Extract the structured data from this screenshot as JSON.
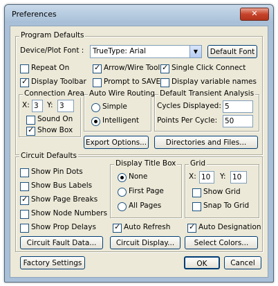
{
  "window": {
    "title": "Preferences",
    "close_label": "✕"
  },
  "program_defaults": {
    "legend": "Program Defaults",
    "font_label": "Device/Plot Font :",
    "font_value": "TrueType: Arial",
    "default_font_button": "Default Font",
    "checkboxes": [
      {
        "label": "Repeat On",
        "checked": false
      },
      {
        "label": "Arrow/Wire Tool",
        "checked": true
      },
      {
        "label": "Single Click Connect",
        "checked": true
      },
      {
        "label": "Display Toolbar",
        "checked": true
      },
      {
        "label": "Prompt to SAVE",
        "checked": false
      },
      {
        "label": "Display variable names",
        "checked": false
      }
    ],
    "connection_area": {
      "legend": "Connection Area",
      "x_label": "X:",
      "x_value": "3",
      "y_label": "Y:",
      "y_value": "3",
      "sound_on": {
        "label": "Sound On",
        "checked": false
      },
      "show_box": {
        "label": "Show Box",
        "checked": true
      }
    },
    "auto_wire_routing": {
      "legend": "Auto Wire Routing",
      "options": [
        {
          "label": "Simple",
          "selected": false
        },
        {
          "label": "Intelligent",
          "selected": true
        }
      ]
    },
    "default_transient": {
      "legend": "Default Transient Analysis",
      "cycles_label": "Cycles Displayed:",
      "cycles_value": "5",
      "points_label": "Points Per Cycle:",
      "points_value": "50"
    },
    "export_button": "Export Options...",
    "directories_button": "Directories and Files..."
  },
  "circuit_defaults": {
    "legend": "Circuit Defaults",
    "checkboxes": [
      {
        "label": "Show Pin Dots",
        "checked": false
      },
      {
        "label": "Show Bus Labels",
        "checked": false
      },
      {
        "label": "Show Page Breaks",
        "checked": true
      },
      {
        "label": "Show Node Numbers",
        "checked": false
      },
      {
        "label": "Show Prop Delays",
        "checked": false
      }
    ],
    "display_title_box": {
      "legend": "Display Title Box",
      "options": [
        {
          "label": "None",
          "selected": true
        },
        {
          "label": "First Page",
          "selected": false
        },
        {
          "label": "All Pages",
          "selected": false
        }
      ]
    },
    "grid": {
      "legend": "Grid",
      "x_label": "X:",
      "x_value": "10",
      "y_label": "Y:",
      "y_value": "10",
      "show_grid": {
        "label": "Show Grid",
        "checked": false
      },
      "snap_to_grid": {
        "label": "Snap To Grid",
        "checked": false
      }
    },
    "auto_refresh": {
      "label": "Auto Refresh",
      "checked": true
    },
    "auto_designation": {
      "label": "Auto Designation",
      "checked": true
    },
    "fault_button": "Circuit Fault Data...",
    "display_button": "Circuit Display...",
    "colors_button": "Select Colors..."
  },
  "footer": {
    "factory_button": "Factory Settings",
    "ok_button": "OK",
    "cancel_button": "Cancel"
  }
}
